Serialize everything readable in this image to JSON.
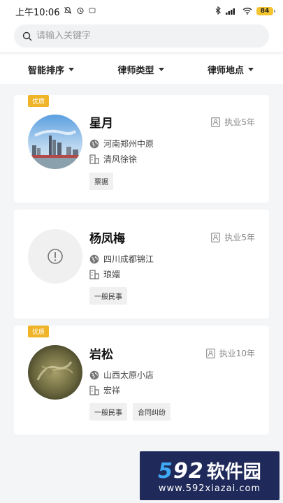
{
  "status_bar": {
    "time": "上午10:06",
    "battery": "84"
  },
  "search": {
    "placeholder": "请输入关键字"
  },
  "filters": [
    {
      "label": "智能排序"
    },
    {
      "label": "律师类型"
    },
    {
      "label": "律师地点"
    }
  ],
  "lawyers": [
    {
      "badge": "优质",
      "name": "星月",
      "years": "执业5年",
      "location": "河南郑州中原",
      "firm": "清风徐徐",
      "tags": [
        "票据"
      ],
      "avatar": "city-skyline-photo"
    },
    {
      "badge": "",
      "name": "杨凤梅",
      "years": "执业5年",
      "location": "四川成都锦江",
      "firm": "琅嬛",
      "tags": [
        "一般民事"
      ],
      "avatar": "placeholder-exclamation"
    },
    {
      "badge": "优质",
      "name": "岩松",
      "years": "执业10年",
      "location": "山西太原小店",
      "firm": "宏祥",
      "tags": [
        "一般民事",
        "合同纠纷"
      ],
      "avatar": "dragon-sculpture-photo"
    }
  ],
  "colors": {
    "badge": "#f0b429",
    "background": "#f4f5f7",
    "watermark_bg": "#1f2a5a",
    "watermark_accent": "#3fa9f5"
  },
  "watermark": {
    "brand_number_a": "5",
    "brand_number_b": "92",
    "brand_text": "软件园",
    "url": "www.592xiazai.com"
  }
}
